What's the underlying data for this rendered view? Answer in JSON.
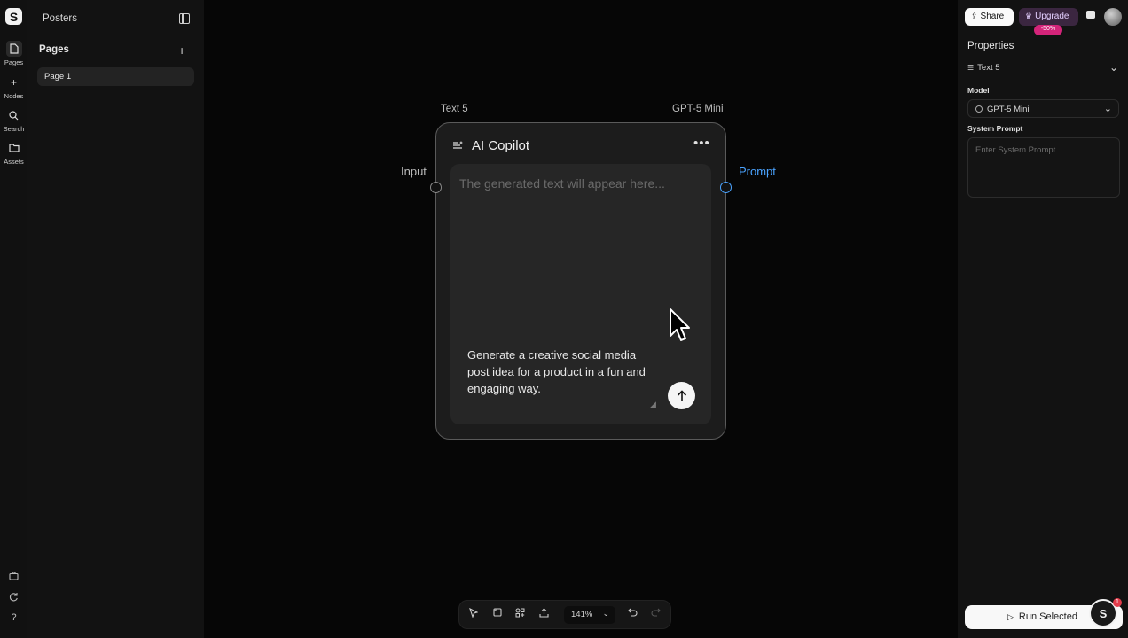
{
  "project": {
    "title": "Posters"
  },
  "rail": {
    "items": [
      {
        "label": "Pages",
        "icon": "page-icon"
      },
      {
        "label": "Nodes",
        "icon": "plus-icon"
      },
      {
        "label": "Search",
        "icon": "search-icon"
      },
      {
        "label": "Assets",
        "icon": "folder-icon"
      }
    ],
    "bottom_icons": [
      "briefcase-icon",
      "refresh-icon",
      "help-icon"
    ],
    "help_glyph": "?"
  },
  "pages": {
    "header": "Pages",
    "items": [
      {
        "label": "Page 1",
        "active": true
      }
    ]
  },
  "node": {
    "name": "Text 5",
    "model": "GPT-5 Mini",
    "title": "AI Copilot",
    "placeholder": "The generated text will appear here...",
    "prompt": "Generate a creative social media post idea for a product in a fun and engaging way.",
    "input_port": "Input",
    "output_port": "Prompt"
  },
  "toolbar": {
    "zoom": "141%"
  },
  "header": {
    "share": "Share",
    "upgrade": "Upgrade",
    "discount": "-50%"
  },
  "properties": {
    "title": "Properties",
    "selected_node": "Text 5",
    "model_label": "Model",
    "model_value": "GPT-5 Mini",
    "system_prompt_label": "System Prompt",
    "system_prompt_placeholder": "Enter System Prompt",
    "run_button": "Run Selected"
  },
  "notifications": {
    "count": "1"
  },
  "colors": {
    "accent": "#4aa3ff",
    "discount": "#d4247a",
    "canvas": "#060606"
  }
}
